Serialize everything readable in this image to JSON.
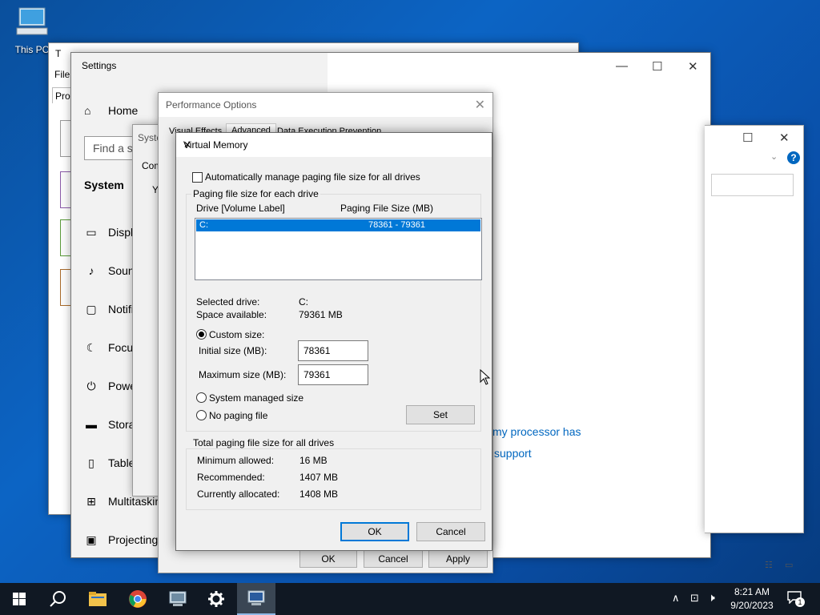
{
  "desktop": {
    "icon_label": "This PC"
  },
  "task_manager": {
    "title_fragment": "T",
    "menu_label": "File",
    "tab_fragment": "Pro"
  },
  "settings": {
    "title": "Settings",
    "home": "Home",
    "search_placeholder": "Find a s",
    "category": "System",
    "items": [
      {
        "label": "Displ",
        "icon": "display-icon"
      },
      {
        "label": "Soun",
        "icon": "speaker-icon"
      },
      {
        "label": "Notifi",
        "icon": "notification-icon"
      },
      {
        "label": "Focu",
        "icon": "moon-icon"
      },
      {
        "label": "Powe",
        "icon": "power-icon"
      },
      {
        "label": "Stora",
        "icon": "storage-icon"
      },
      {
        "label": "Table",
        "icon": "tablet-icon"
      },
      {
        "label": "Multitaskin",
        "icon": "multitasking-icon"
      },
      {
        "label": "Projecting",
        "icon": "projecting-icon"
      }
    ],
    "link1": "my processor has",
    "link2": "support"
  },
  "system_properties": {
    "title_fragment": "Syste",
    "tab_fragment": "Com",
    "text_fragment": "Yo",
    "buttons": {
      "ok": "OK",
      "cancel": "Cancel",
      "apply": "Apply"
    }
  },
  "performance_options": {
    "title": "Performance Options",
    "tabs": [
      "Visual Effects",
      "Advanced",
      "Data Execution Prevention"
    ]
  },
  "virtual_memory": {
    "title": "Virtual Memory",
    "auto_manage_label": "Automatically manage paging file size for all drives",
    "auto_manage_checked": false,
    "group_each_drive": "Paging file size for each drive",
    "col_drive": "Drive  [Volume Label]",
    "col_size": "Paging File Size (MB)",
    "drives": [
      {
        "drive": "C:",
        "size": "78361 - 79361"
      }
    ],
    "selected_drive_label": "Selected drive:",
    "selected_drive_value": "C:",
    "space_available_label": "Space available:",
    "space_available_value": "79361 MB",
    "custom_size_label": "Custom size:",
    "initial_size_label": "Initial size (MB):",
    "initial_size_value": "78361",
    "max_size_label": "Maximum size (MB):",
    "max_size_value": "79361",
    "system_managed_label": "System managed size",
    "no_paging_label": "No paging file",
    "selected_option": "custom",
    "set_button": "Set",
    "group_total": "Total paging file size for all drives",
    "min_allowed_label": "Minimum allowed:",
    "min_allowed_value": "16 MB",
    "recommended_label": "Recommended:",
    "recommended_value": "1407 MB",
    "currently_allocated_label": "Currently allocated:",
    "currently_allocated_value": "1408 MB",
    "ok_button": "OK",
    "cancel_button": "Cancel"
  },
  "taskbar": {
    "apps": [
      "start-icon",
      "search-icon",
      "file-explorer-icon",
      "chrome-icon",
      "system-properties-icon",
      "settings-gear-icon",
      "performance-monitor-icon"
    ],
    "time": "8:21 AM",
    "date": "9/20/2023",
    "notification_count": "1"
  },
  "colors": {
    "accent": "#0078d7",
    "taskbar": "#101823",
    "link": "#0067c0"
  }
}
